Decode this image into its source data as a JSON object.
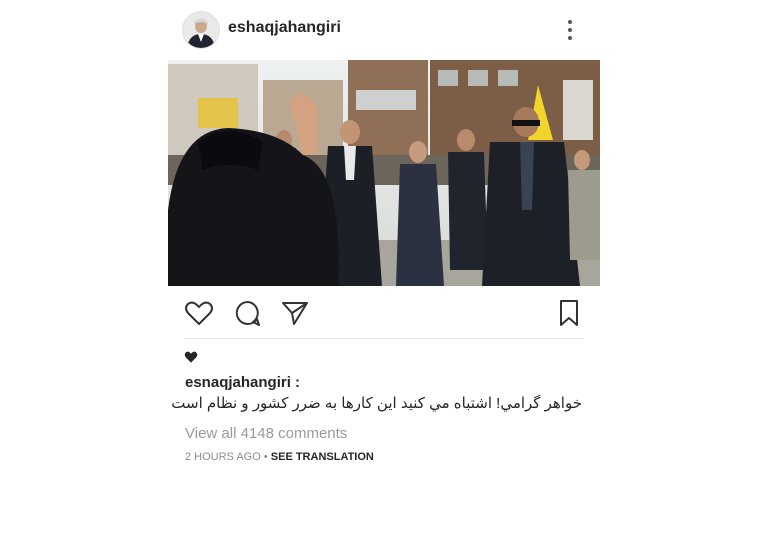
{
  "post": {
    "username": "eshaqjahangiri",
    "caption_username": "esnaqjahangiri :",
    "caption_text": "خواهر گرامي! اشتباه مي کنيد اين کارها به ضرر کشور و نظام است",
    "comments_link": "View all 4148 comments",
    "timestamp": "2 HOURS AGO",
    "meta_separator": " • ",
    "translation_link": "SEE TRANSLATION"
  },
  "icons": {
    "more": "more-vertical-icon",
    "like": "heart-outline-icon",
    "comment": "comment-bubble-icon",
    "share": "paper-plane-icon",
    "save": "bookmark-icon",
    "likes": "heart-filled-icon"
  },
  "colors": {
    "text": "#262626",
    "secondary": "#9a9a9a",
    "separator": "#e6e6e6"
  }
}
